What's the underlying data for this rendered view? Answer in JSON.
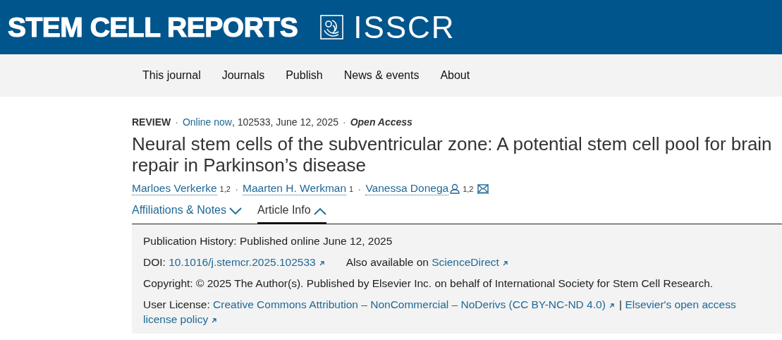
{
  "header": {
    "journal_title": "STEM CELL REPORTS",
    "society": "ISSCR"
  },
  "nav": [
    "This journal",
    "Journals",
    "Publish",
    "News & events",
    "About"
  ],
  "meta": [
    {
      "kind": "type",
      "text": "REVIEW"
    },
    {
      "kind": "sep",
      "text": "·"
    },
    {
      "kind": "link",
      "text": "Online now"
    },
    {
      "kind": "text",
      "text": ", 102533, June 12, 2025"
    },
    {
      "kind": "sep",
      "text": "·"
    },
    {
      "kind": "access",
      "text": "Open Access"
    }
  ],
  "title": "Neural stem cells of the subventricular zone: A potential stem cell pool for brain repair in Parkinson’s disease",
  "authors": [
    {
      "kind": "author",
      "name": "Marloes Verkerke",
      "sup": "1,2"
    },
    {
      "kind": "author",
      "separator": "·",
      "name": "Maarten H. Werkman",
      "sup": "1"
    },
    {
      "kind": "corresponding",
      "separator": "·",
      "name": "Vanessa Donega",
      "sup": "1,2"
    }
  ],
  "tabs": [
    {
      "label": "Affiliations & Notes",
      "selected": false
    },
    {
      "label": "Article Info",
      "selected": true
    }
  ],
  "info": [
    [
      {
        "kind": "text",
        "text": "Publication History:  Published online June 12, 2025"
      }
    ],
    [
      {
        "kind": "text",
        "text": "DOI: "
      },
      {
        "kind": "ext-link",
        "text": "10.1016/j.stemcr.2025.102533"
      },
      {
        "kind": "gap",
        "text": "Also available on "
      },
      {
        "kind": "ext-link",
        "text": "ScienceDirect"
      }
    ],
    [
      {
        "kind": "text",
        "text": "Copyright: © 2025 The Author(s). Published by Elsevier Inc. on behalf of International Society for Stem Cell Research."
      }
    ],
    [
      {
        "kind": "text",
        "text": "User License: "
      },
      {
        "kind": "ext-link",
        "text": "Creative Commons Attribution – NonCommercial – NoDerivs (CC BY-NC-ND 4.0)"
      },
      {
        "kind": "text",
        "text": " | "
      },
      {
        "kind": "link",
        "text": "Elsevier's open access"
      },
      {
        "kind": "space"
      },
      {
        "kind": "ext-link",
        "text": "license policy"
      }
    ]
  ]
}
